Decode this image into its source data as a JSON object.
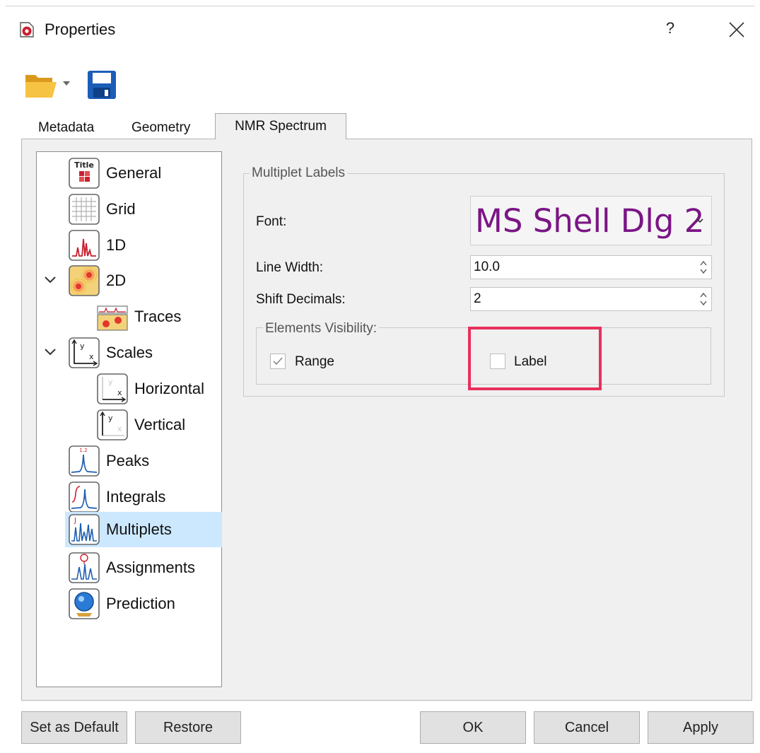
{
  "window": {
    "title": "Properties",
    "help_label": "?",
    "icons": {
      "app": "app-logo-icon",
      "close": "close-icon"
    }
  },
  "toolbar": {
    "icons": [
      "folder-open-icon",
      "dropdown-arrow-icon",
      "save-icon"
    ]
  },
  "tabs": [
    {
      "label": "Metadata",
      "active": false
    },
    {
      "label": "Geometry",
      "active": false
    },
    {
      "label": "NMR Spectrum",
      "active": true
    }
  ],
  "tree": {
    "items": [
      {
        "label": "General",
        "icon": "title-general-icon"
      },
      {
        "label": "Grid",
        "icon": "grid-icon"
      },
      {
        "label": "1D",
        "icon": "spectrum-1d-icon"
      },
      {
        "label": "2D",
        "icon": "spectrum-2d-icon",
        "expanded": true
      },
      {
        "label": "Traces",
        "icon": "traces-icon"
      },
      {
        "label": "Scales",
        "icon": "scales-icon",
        "expanded": true
      },
      {
        "label": "Horizontal",
        "icon": "horizontal-scale-icon"
      },
      {
        "label": "Vertical",
        "icon": "vertical-scale-icon"
      },
      {
        "label": "Peaks",
        "icon": "peaks-icon"
      },
      {
        "label": "Integrals",
        "icon": "integrals-icon"
      },
      {
        "label": "Multiplets",
        "icon": "multiplets-icon",
        "selected": true
      },
      {
        "label": "Assignments",
        "icon": "assignments-icon"
      },
      {
        "label": "Prediction",
        "icon": "prediction-icon"
      }
    ]
  },
  "multiplet_labels": {
    "group_title": "Multiplet Labels",
    "font_label": "Font:",
    "font_value": "MS Shell Dlg 2",
    "line_width_label": "Line Width:",
    "line_width_value": "10.0",
    "shift_decimals_label": "Shift Decimals:",
    "shift_decimals_value": "2",
    "visibility": {
      "group_title": "Elements Visibility:",
      "range_label": "Range",
      "range_checked": true,
      "label_label": "Label",
      "label_checked": false
    }
  },
  "buttons": {
    "set_default": "Set as Default",
    "restore": "Restore",
    "ok": "OK",
    "cancel": "Cancel",
    "apply": "Apply"
  },
  "colors": {
    "highlight": "#e8305c",
    "font_preview": "#7a1585",
    "selection": "#cce8ff"
  }
}
